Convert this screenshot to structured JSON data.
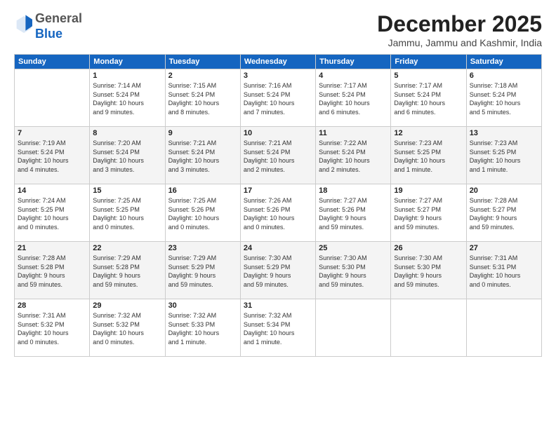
{
  "header": {
    "logo_general": "General",
    "logo_blue": "Blue",
    "month_title": "December 2025",
    "location": "Jammu, Jammu and Kashmir, India"
  },
  "weekdays": [
    "Sunday",
    "Monday",
    "Tuesday",
    "Wednesday",
    "Thursday",
    "Friday",
    "Saturday"
  ],
  "weeks": [
    [
      {
        "num": "",
        "info": ""
      },
      {
        "num": "1",
        "info": "Sunrise: 7:14 AM\nSunset: 5:24 PM\nDaylight: 10 hours\nand 9 minutes."
      },
      {
        "num": "2",
        "info": "Sunrise: 7:15 AM\nSunset: 5:24 PM\nDaylight: 10 hours\nand 8 minutes."
      },
      {
        "num": "3",
        "info": "Sunrise: 7:16 AM\nSunset: 5:24 PM\nDaylight: 10 hours\nand 7 minutes."
      },
      {
        "num": "4",
        "info": "Sunrise: 7:17 AM\nSunset: 5:24 PM\nDaylight: 10 hours\nand 6 minutes."
      },
      {
        "num": "5",
        "info": "Sunrise: 7:17 AM\nSunset: 5:24 PM\nDaylight: 10 hours\nand 6 minutes."
      },
      {
        "num": "6",
        "info": "Sunrise: 7:18 AM\nSunset: 5:24 PM\nDaylight: 10 hours\nand 5 minutes."
      }
    ],
    [
      {
        "num": "7",
        "info": "Sunrise: 7:19 AM\nSunset: 5:24 PM\nDaylight: 10 hours\nand 4 minutes."
      },
      {
        "num": "8",
        "info": "Sunrise: 7:20 AM\nSunset: 5:24 PM\nDaylight: 10 hours\nand 3 minutes."
      },
      {
        "num": "9",
        "info": "Sunrise: 7:21 AM\nSunset: 5:24 PM\nDaylight: 10 hours\nand 3 minutes."
      },
      {
        "num": "10",
        "info": "Sunrise: 7:21 AM\nSunset: 5:24 PM\nDaylight: 10 hours\nand 2 minutes."
      },
      {
        "num": "11",
        "info": "Sunrise: 7:22 AM\nSunset: 5:24 PM\nDaylight: 10 hours\nand 2 minutes."
      },
      {
        "num": "12",
        "info": "Sunrise: 7:23 AM\nSunset: 5:25 PM\nDaylight: 10 hours\nand 1 minute."
      },
      {
        "num": "13",
        "info": "Sunrise: 7:23 AM\nSunset: 5:25 PM\nDaylight: 10 hours\nand 1 minute."
      }
    ],
    [
      {
        "num": "14",
        "info": "Sunrise: 7:24 AM\nSunset: 5:25 PM\nDaylight: 10 hours\nand 0 minutes."
      },
      {
        "num": "15",
        "info": "Sunrise: 7:25 AM\nSunset: 5:25 PM\nDaylight: 10 hours\nand 0 minutes."
      },
      {
        "num": "16",
        "info": "Sunrise: 7:25 AM\nSunset: 5:26 PM\nDaylight: 10 hours\nand 0 minutes."
      },
      {
        "num": "17",
        "info": "Sunrise: 7:26 AM\nSunset: 5:26 PM\nDaylight: 10 hours\nand 0 minutes."
      },
      {
        "num": "18",
        "info": "Sunrise: 7:27 AM\nSunset: 5:26 PM\nDaylight: 9 hours\nand 59 minutes."
      },
      {
        "num": "19",
        "info": "Sunrise: 7:27 AM\nSunset: 5:27 PM\nDaylight: 9 hours\nand 59 minutes."
      },
      {
        "num": "20",
        "info": "Sunrise: 7:28 AM\nSunset: 5:27 PM\nDaylight: 9 hours\nand 59 minutes."
      }
    ],
    [
      {
        "num": "21",
        "info": "Sunrise: 7:28 AM\nSunset: 5:28 PM\nDaylight: 9 hours\nand 59 minutes."
      },
      {
        "num": "22",
        "info": "Sunrise: 7:29 AM\nSunset: 5:28 PM\nDaylight: 9 hours\nand 59 minutes."
      },
      {
        "num": "23",
        "info": "Sunrise: 7:29 AM\nSunset: 5:29 PM\nDaylight: 9 hours\nand 59 minutes."
      },
      {
        "num": "24",
        "info": "Sunrise: 7:30 AM\nSunset: 5:29 PM\nDaylight: 9 hours\nand 59 minutes."
      },
      {
        "num": "25",
        "info": "Sunrise: 7:30 AM\nSunset: 5:30 PM\nDaylight: 9 hours\nand 59 minutes."
      },
      {
        "num": "26",
        "info": "Sunrise: 7:30 AM\nSunset: 5:30 PM\nDaylight: 9 hours\nand 59 minutes."
      },
      {
        "num": "27",
        "info": "Sunrise: 7:31 AM\nSunset: 5:31 PM\nDaylight: 10 hours\nand 0 minutes."
      }
    ],
    [
      {
        "num": "28",
        "info": "Sunrise: 7:31 AM\nSunset: 5:32 PM\nDaylight: 10 hours\nand 0 minutes."
      },
      {
        "num": "29",
        "info": "Sunrise: 7:32 AM\nSunset: 5:32 PM\nDaylight: 10 hours\nand 0 minutes."
      },
      {
        "num": "30",
        "info": "Sunrise: 7:32 AM\nSunset: 5:33 PM\nDaylight: 10 hours\nand 1 minute."
      },
      {
        "num": "31",
        "info": "Sunrise: 7:32 AM\nSunset: 5:34 PM\nDaylight: 10 hours\nand 1 minute."
      },
      {
        "num": "",
        "info": ""
      },
      {
        "num": "",
        "info": ""
      },
      {
        "num": "",
        "info": ""
      }
    ]
  ]
}
